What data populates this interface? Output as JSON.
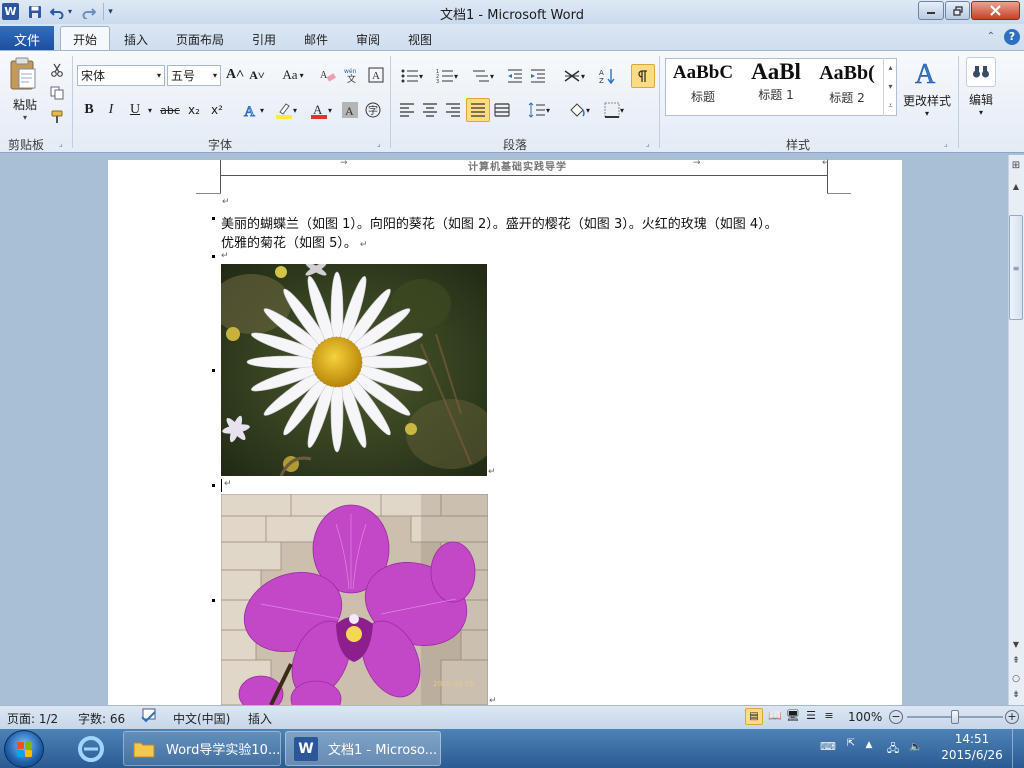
{
  "window": {
    "title": "文档1 - Microsoft Word",
    "app_icon": "W"
  },
  "quick_access": [
    "save-icon",
    "undo-icon",
    "redo-icon",
    "customize-icon"
  ],
  "tabs": [
    {
      "label": "文件"
    },
    {
      "label": "开始"
    },
    {
      "label": "插入"
    },
    {
      "label": "页面布局"
    },
    {
      "label": "引用"
    },
    {
      "label": "邮件"
    },
    {
      "label": "审阅"
    },
    {
      "label": "视图"
    }
  ],
  "ribbon": {
    "clipboard": {
      "paste_label": "粘贴",
      "group_label": "剪贴板"
    },
    "font": {
      "font_name": "宋体",
      "font_size": "五号",
      "group_label": "字体",
      "grow": "A˄",
      "shrink": "A˅",
      "change_case": "Aa",
      "bold": "B",
      "italic": "I",
      "underline": "U",
      "strike": "abc",
      "subscript": "x₂",
      "superscript": "x²"
    },
    "paragraph": {
      "group_label": "段落"
    },
    "styles": {
      "group_label": "样式",
      "items": [
        {
          "sample": "AaBbC",
          "name": "标题"
        },
        {
          "sample": "AaBl",
          "name": "标题 1"
        },
        {
          "sample": "AaBb(",
          "name": "标题 2"
        }
      ],
      "change_styles": "更改样式"
    },
    "editing": {
      "label": "编辑"
    }
  },
  "document": {
    "header_text": "计算机基础实践导学",
    "paragraph_line1": "美丽的蝴蝶兰（如图 1）。向阳的葵花（如图 2）。盛开的樱花（如图 3）。火红的玫瑰（如图 4）。",
    "paragraph_line2": "优雅的菊花（如图 5）。",
    "photo2_stamp": "2015-03-26"
  },
  "status": {
    "page": "页面: 1/2",
    "words": "字数: 66",
    "language": "中文(中国)",
    "mode": "插入",
    "zoom": "100%",
    "zoom_level": 1.0
  },
  "taskbar": {
    "items": [
      {
        "label": "Word导学实验10..."
      },
      {
        "label": "文档1 - Microso..."
      }
    ],
    "time": "14:51",
    "date": "2015/6/26"
  },
  "colors": {
    "file_tab": "#2a63b3",
    "accent": "#2b579a",
    "highlight": "#ffeb3b",
    "font_color": "#e03030"
  }
}
